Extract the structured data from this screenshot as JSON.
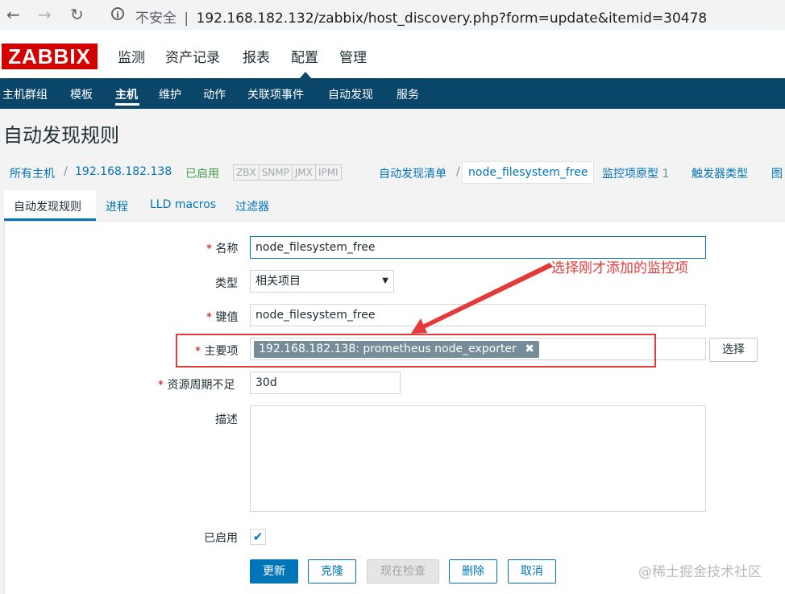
{
  "browser": {
    "insecure_label": "不安全",
    "separator": "|",
    "url": "192.168.182.132/zabbix/host_discovery.php?form=update&itemid=30478"
  },
  "logo": "ZABBIX",
  "top_menu": [
    "监测",
    "资产记录",
    "报表",
    "配置",
    "管理"
  ],
  "sub_menu": [
    "主机群组",
    "模板",
    "主机",
    "维护",
    "动作",
    "关联项事件",
    "自动发现",
    "服务"
  ],
  "page_title": "自动发现规则",
  "breadcrumb": {
    "all_hosts": "所有主机",
    "sep": "/",
    "host": "192.168.182.138",
    "enabled": "已启用",
    "tags": [
      "ZBX",
      "SNMP",
      "JMX",
      "IPMI"
    ],
    "discovery_list": "自动发现清单",
    "current": "node_filesystem_free",
    "item_prototypes": "监控项原型",
    "item_prototypes_count": "1",
    "trigger_types": "触发器类型",
    "graph": "图"
  },
  "tabs": [
    "自动发现规则",
    "进程",
    "LLD macros",
    "过滤器"
  ],
  "form": {
    "required_mark": "*",
    "name_label": "名称",
    "name_value": "node_filesystem_free",
    "type_label": "类型",
    "type_value": "相关项目",
    "key_label": "键值",
    "key_value": "node_filesystem_free",
    "master_label": "主要项",
    "master_value": "192.168.182.138: prometheus node_exporter",
    "select_button": "选择",
    "lifetime_label": "资源周期不足",
    "lifetime_value": "30d",
    "desc_label": "描述",
    "desc_value": "",
    "enabled_label": "已启用"
  },
  "buttons": {
    "update": "更新",
    "clone": "克隆",
    "check_now": "现在检查",
    "delete": "删除",
    "cancel": "取消"
  },
  "annotation": "选择刚才添加的监控项",
  "watermark": "@稀土掘金技术社区",
  "colors": {
    "brand_red": "#d40000",
    "nav_blue": "#0a466a",
    "link_blue": "#0275b8",
    "annotation_red": "#e53a3a"
  }
}
